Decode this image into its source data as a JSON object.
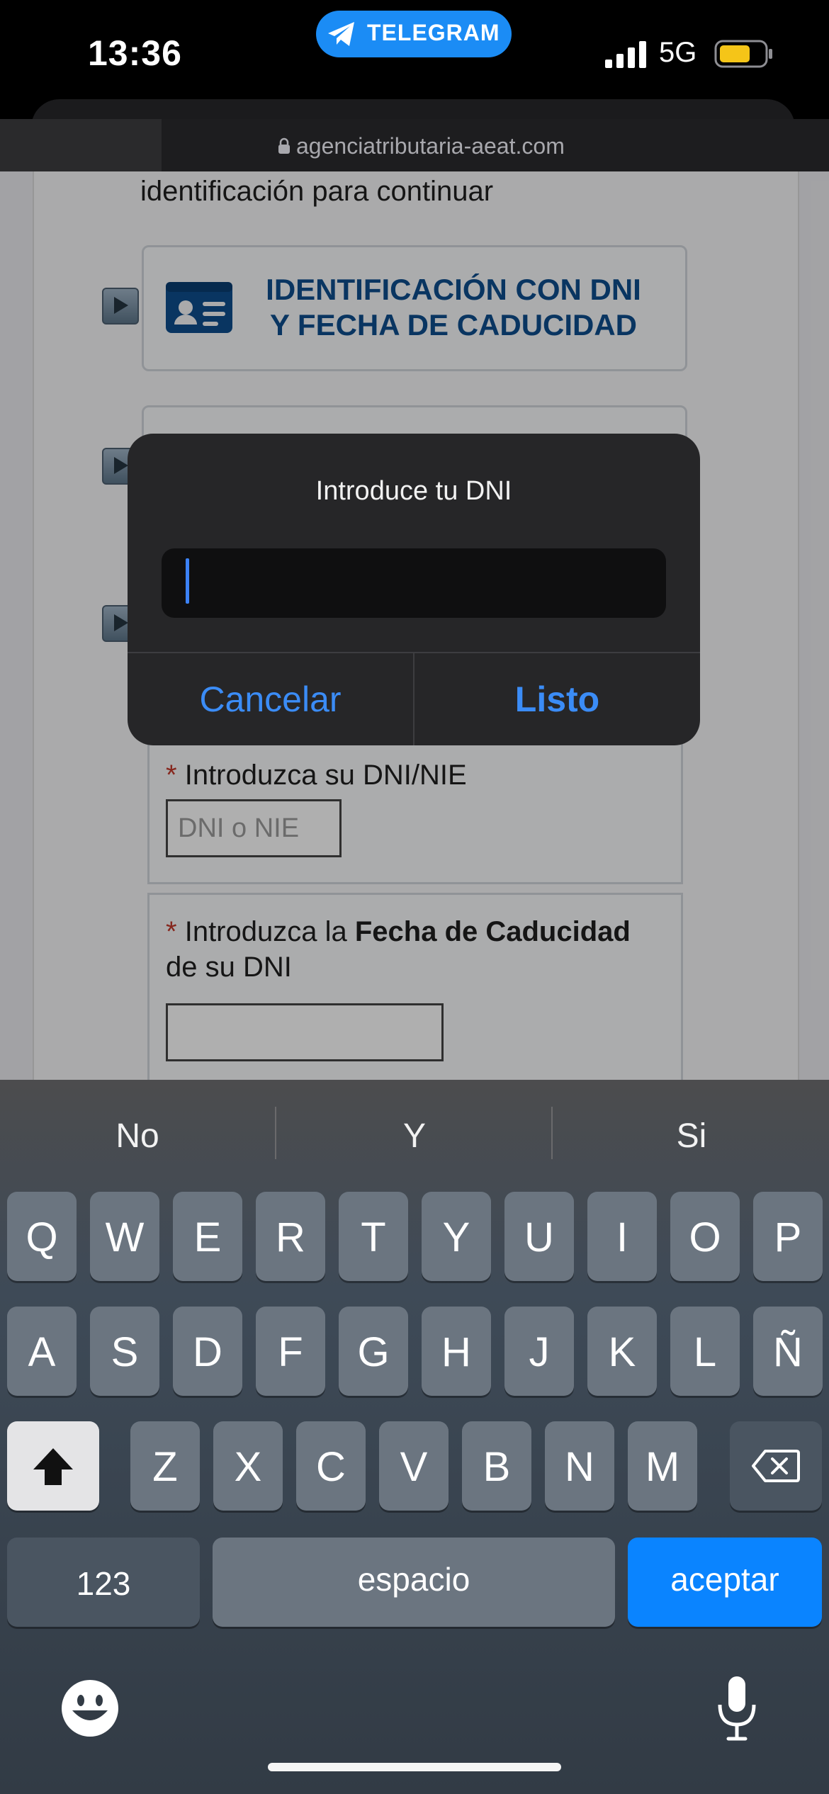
{
  "status_bar": {
    "time": "13:36",
    "app_pill": "TELEGRAM",
    "network": "5G",
    "battery_color": "#f5c518"
  },
  "browser": {
    "url": "agenciatributaria-aeat.com"
  },
  "page": {
    "instruction": "identificación para continuar",
    "option_dni_line1": "IDENTIFICACIÓN CON DNI",
    "option_dni_line2": "Y FECHA DE CADUCIDAD",
    "dni_label": "Introduzca su DNI/NIE",
    "dni_placeholder": "DNI o NIE",
    "fecha_label_prefix": "Introduzca la ",
    "fecha_label_bold": "Fecha de Caducidad",
    "fecha_label_suffix": " de su DNI",
    "required_mark": "*"
  },
  "dialog": {
    "title": "Introduce tu DNI",
    "input_value": "",
    "cancel_label": "Cancelar",
    "done_label": "Listo"
  },
  "keyboard": {
    "suggestions": [
      "No",
      "Y",
      "Si"
    ],
    "row1": [
      "Q",
      "W",
      "E",
      "R",
      "T",
      "Y",
      "U",
      "I",
      "O",
      "P"
    ],
    "row2": [
      "A",
      "S",
      "D",
      "F",
      "G",
      "H",
      "J",
      "K",
      "L",
      "Ñ"
    ],
    "row3": [
      "Z",
      "X",
      "C",
      "V",
      "B",
      "N",
      "M"
    ],
    "numbers_label": "123",
    "space_label": "espacio",
    "enter_label": "aceptar"
  }
}
